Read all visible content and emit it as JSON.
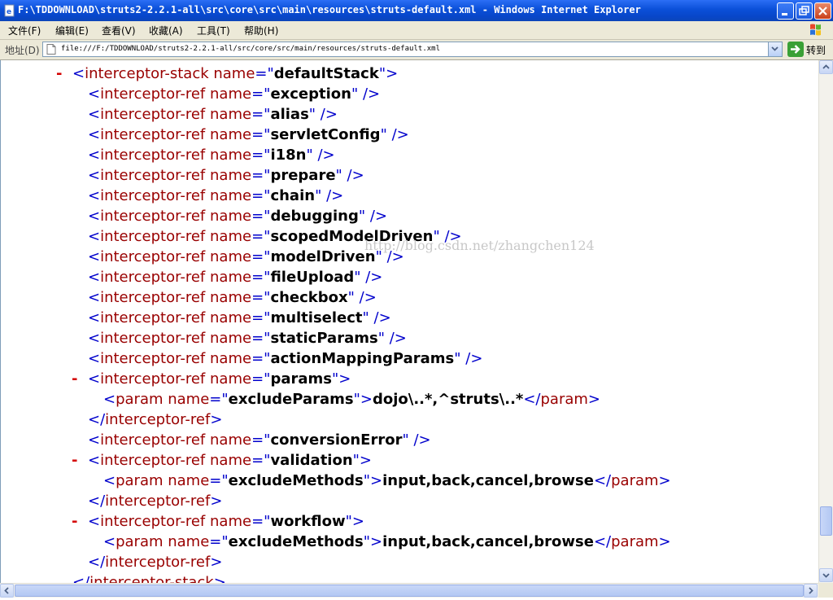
{
  "window": {
    "title": "F:\\TDDOWNLOAD\\struts2-2.2.1-all\\src\\core\\src\\main\\resources\\struts-default.xml - Windows Internet Explorer",
    "app_icon": "ie-document-icon",
    "buttons": [
      "minimize-icon",
      "maximize-icon",
      "close-icon"
    ]
  },
  "menu": {
    "items": [
      "文件(F)",
      "编辑(E)",
      "查看(V)",
      "收藏(A)",
      "工具(T)",
      "帮助(H)"
    ]
  },
  "address": {
    "label": "地址(D)",
    "url": "file:///F:/TDDOWNLOAD/struts2-2.2.1-all/src/core/src/main/resources/struts-default.xml",
    "go_label": "转到"
  },
  "watermark": "http://blog.csdn.net/zhangchen124",
  "colors": {
    "tag": "#990000",
    "punct": "#0000cc",
    "minus": "#d40000",
    "value": "#000000"
  },
  "xml_lines": [
    {
      "indent": 0,
      "collapse": true,
      "kind": "open",
      "tag": "interceptor-stack",
      "attr": "name",
      "value": "defaultStack"
    },
    {
      "indent": 1,
      "kind": "empty",
      "tag": "interceptor-ref",
      "attr": "name",
      "value": "exception"
    },
    {
      "indent": 1,
      "kind": "empty",
      "tag": "interceptor-ref",
      "attr": "name",
      "value": "alias"
    },
    {
      "indent": 1,
      "kind": "empty",
      "tag": "interceptor-ref",
      "attr": "name",
      "value": "servletConfig"
    },
    {
      "indent": 1,
      "kind": "empty",
      "tag": "interceptor-ref",
      "attr": "name",
      "value": "i18n"
    },
    {
      "indent": 1,
      "kind": "empty",
      "tag": "interceptor-ref",
      "attr": "name",
      "value": "prepare"
    },
    {
      "indent": 1,
      "kind": "empty",
      "tag": "interceptor-ref",
      "attr": "name",
      "value": "chain"
    },
    {
      "indent": 1,
      "kind": "empty",
      "tag": "interceptor-ref",
      "attr": "name",
      "value": "debugging"
    },
    {
      "indent": 1,
      "kind": "empty",
      "tag": "interceptor-ref",
      "attr": "name",
      "value": "scopedModelDriven"
    },
    {
      "indent": 1,
      "kind": "empty",
      "tag": "interceptor-ref",
      "attr": "name",
      "value": "modelDriven"
    },
    {
      "indent": 1,
      "kind": "empty",
      "tag": "interceptor-ref",
      "attr": "name",
      "value": "fileUpload"
    },
    {
      "indent": 1,
      "kind": "empty",
      "tag": "interceptor-ref",
      "attr": "name",
      "value": "checkbox"
    },
    {
      "indent": 1,
      "kind": "empty",
      "tag": "interceptor-ref",
      "attr": "name",
      "value": "multiselect"
    },
    {
      "indent": 1,
      "kind": "empty",
      "tag": "interceptor-ref",
      "attr": "name",
      "value": "staticParams"
    },
    {
      "indent": 1,
      "kind": "empty",
      "tag": "interceptor-ref",
      "attr": "name",
      "value": "actionMappingParams"
    },
    {
      "indent": 1,
      "collapse": true,
      "kind": "open",
      "tag": "interceptor-ref",
      "attr": "name",
      "value": "params"
    },
    {
      "indent": 2,
      "kind": "inline",
      "tag": "param",
      "attr": "name",
      "value": "excludeParams",
      "text": "dojo\\..*,^struts\\..*"
    },
    {
      "indent": 1,
      "kind": "close",
      "tag": "interceptor-ref"
    },
    {
      "indent": 1,
      "kind": "empty",
      "tag": "interceptor-ref",
      "attr": "name",
      "value": "conversionError"
    },
    {
      "indent": 1,
      "collapse": true,
      "kind": "open",
      "tag": "interceptor-ref",
      "attr": "name",
      "value": "validation"
    },
    {
      "indent": 2,
      "kind": "inline",
      "tag": "param",
      "attr": "name",
      "value": "excludeMethods",
      "text": "input,back,cancel,browse"
    },
    {
      "indent": 1,
      "kind": "close",
      "tag": "interceptor-ref"
    },
    {
      "indent": 1,
      "collapse": true,
      "kind": "open",
      "tag": "interceptor-ref",
      "attr": "name",
      "value": "workflow"
    },
    {
      "indent": 2,
      "kind": "inline",
      "tag": "param",
      "attr": "name",
      "value": "excludeMethods",
      "text": "input,back,cancel,browse"
    },
    {
      "indent": 1,
      "kind": "close",
      "tag": "interceptor-ref"
    },
    {
      "indent": 0,
      "kind": "close",
      "tag": "interceptor-stack"
    }
  ]
}
